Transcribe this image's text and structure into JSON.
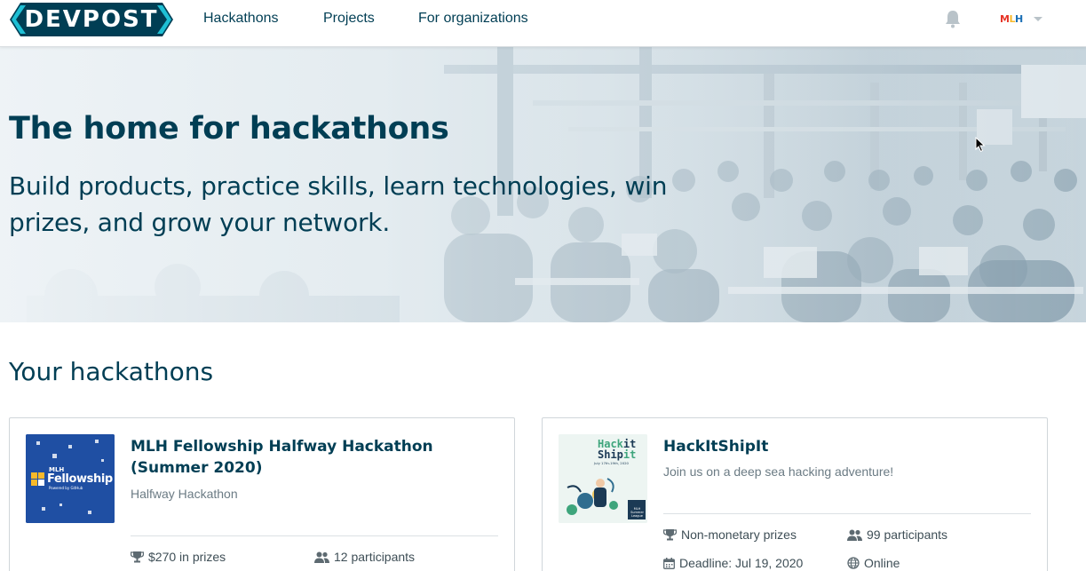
{
  "header": {
    "logo_text": "DEVPOST",
    "nav": [
      "Hackathons",
      "Projects",
      "For organizations"
    ],
    "user_badge": {
      "m": "M",
      "l": "L",
      "h": "H"
    }
  },
  "hero": {
    "title": "The home for hackathons",
    "subtitle": "Build products, practice skills, learn technologies, win prizes, and grow your network."
  },
  "section": {
    "title": "Your hackathons"
  },
  "hackathons": [
    {
      "title": "MLH Fellowship Halfway Hackathon (Summer 2020)",
      "tagline": "Halfway Hackathon",
      "thumb_line1": "MLH",
      "thumb_line2": "Fellowship",
      "thumb_line3": "Powered by GitHub",
      "prizes": "$270 in prizes",
      "participants": "12 participants"
    },
    {
      "title": "HackItShipIt",
      "tagline": "Join us on a deep sea hacking adventure!",
      "thumb_line1": "Hack",
      "thumb_line1b": "it",
      "thumb_line2": "Ship",
      "thumb_line2b": "it",
      "thumb_date": "July 17th-19th, 2020",
      "thumb_badge": "MLH Summer League",
      "prizes": "Non-monetary prizes",
      "participants": "99 participants",
      "deadline": "Deadline: Jul 19, 2020",
      "location": "Online"
    }
  ],
  "colors": {
    "brand": "#003e54",
    "logo_bg": "#003e54",
    "accent": "#1ebfd4",
    "fellowship_bg": "#1f4fa3"
  }
}
